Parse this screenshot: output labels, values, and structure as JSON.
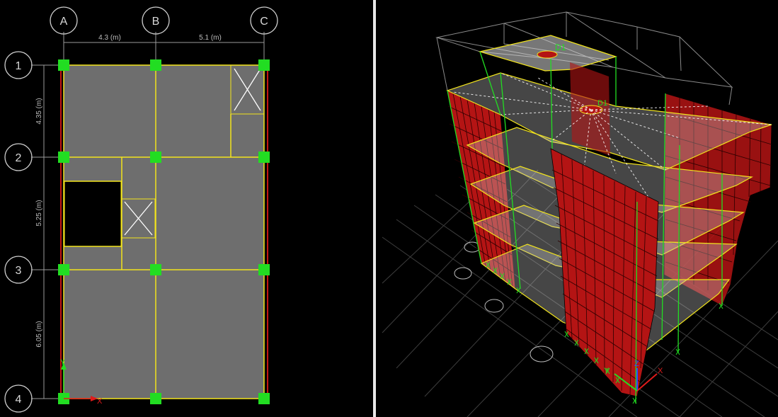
{
  "plan_view": {
    "column_grid_labels": [
      "A",
      "B",
      "C"
    ],
    "row_grid_labels": [
      "1",
      "2",
      "3",
      "4"
    ],
    "horizontal_spacings": [
      "4.3 (m)",
      "5.1 (m)"
    ],
    "vertical_spacings": [
      "4.35 (m)",
      "5.25 (m)",
      "6.05 (m)"
    ],
    "axis_labels": {
      "y": "Y",
      "x": "X"
    }
  },
  "iso_view": {
    "diaphragm_labels": [
      "D1",
      "D1"
    ],
    "axis_labels": {
      "x": "X",
      "y": "Y",
      "z": "Z"
    }
  },
  "colors": {
    "background": "#000000",
    "slab": "#6e6e6e",
    "beam": "#f2e41c",
    "support": "#22dd22",
    "wall": "#b41414",
    "frame_edge": "#8a8a8a",
    "grid_bubble": "#cfcfcf",
    "x_axis": "#e01b1b",
    "y_axis": "#22dd22",
    "z_axis": "#2a4bff"
  }
}
